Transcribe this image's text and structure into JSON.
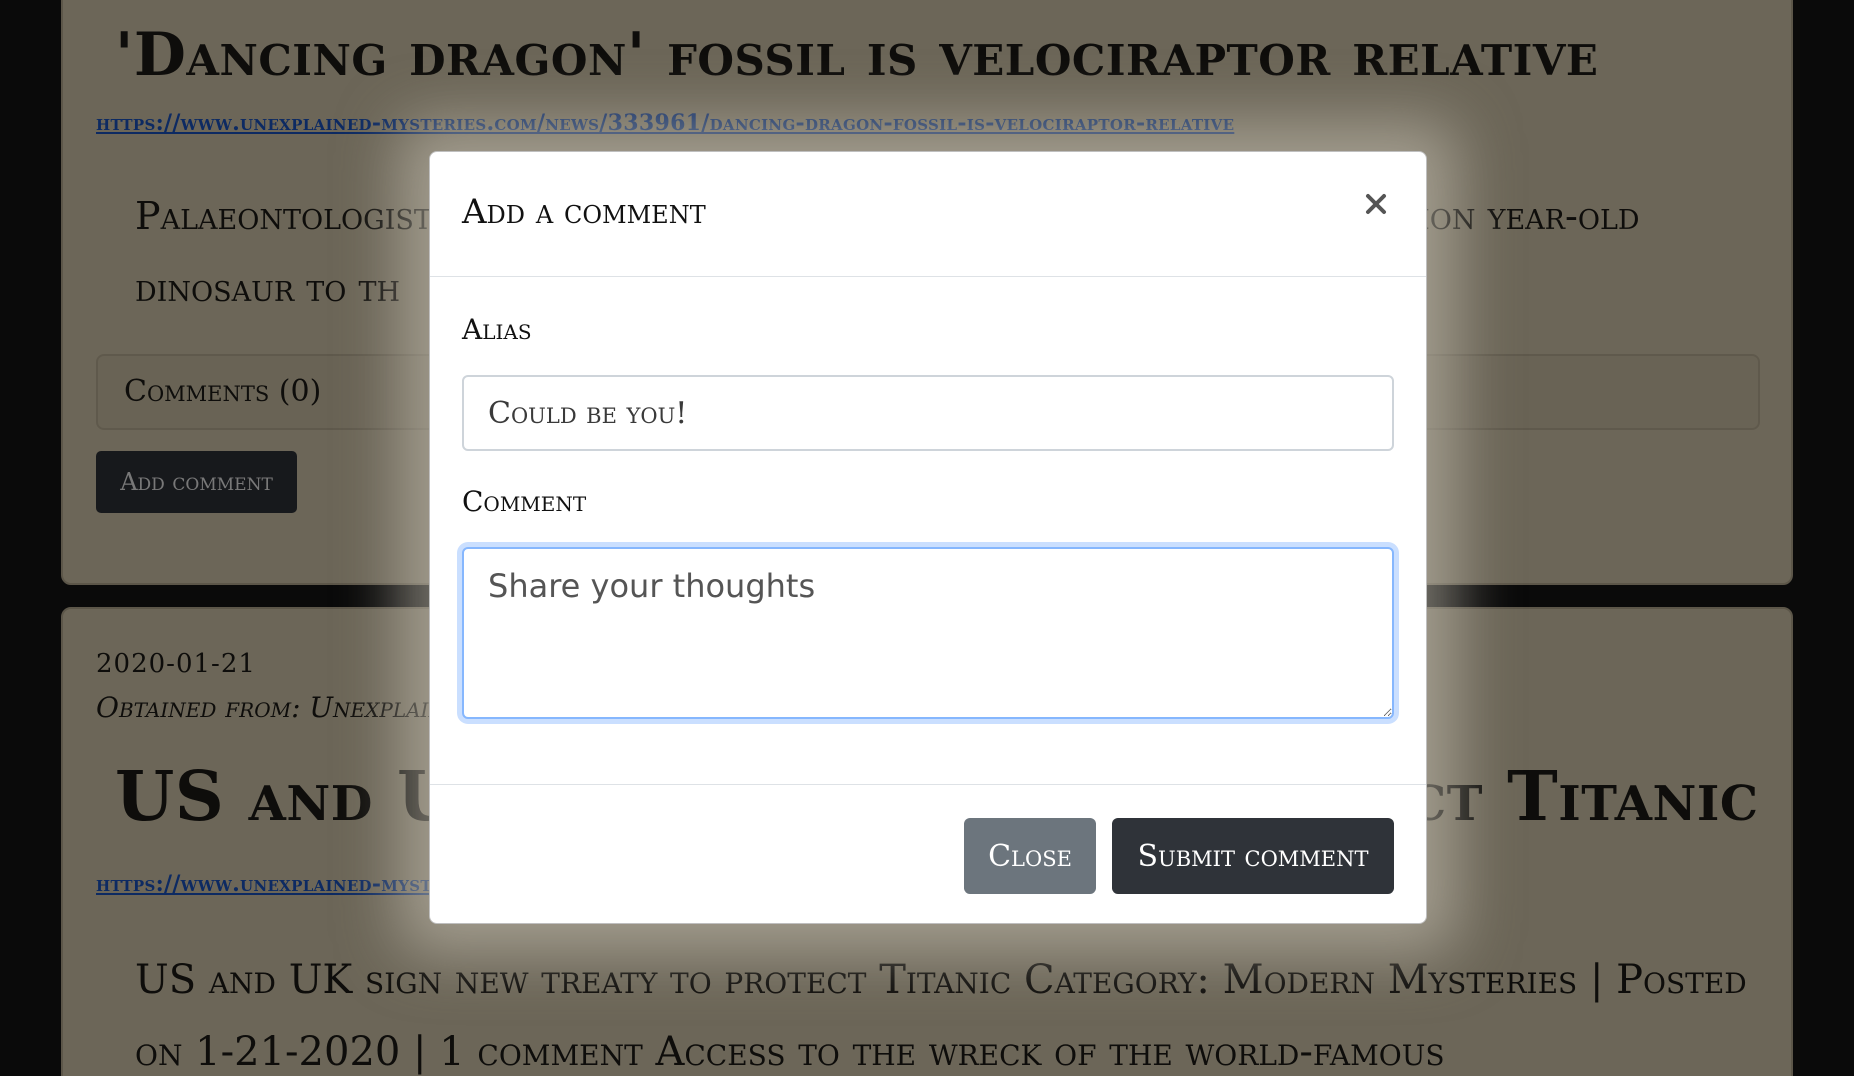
{
  "articles": [
    {
      "title": "'Dancing dragon' fossil is velociraptor relative",
      "link": "https://www.unexplained-mysteries.com/news/333961/dancing-dragon-fossil-is-velociraptor-relative",
      "body": "Palaeontologists have discovered the fossilized remains of a 120 million year-old dinosaur to th",
      "comments_label": "Comments (0)",
      "add_comment_label": "Add comment"
    },
    {
      "date": "2020-01-21",
      "source": "Obtained from: Unexplained Mysteries",
      "title": "US and UK sign new treaty to protect Titanic",
      "link": "https://www.unexplained-mysteries.com/news/333962/us-and-uk-sign-new-treaty-to-protect-titanic",
      "body": "US and UK sign new treaty to protect Titanic Category: Modern Mysteries | Posted on 1-21-2020 | 1 comment Access to the wreck of the world-famous"
    }
  ],
  "modal": {
    "title": "Add a comment",
    "close_icon": "close-icon",
    "alias_label": "Alias",
    "alias_placeholder": "Could be you!",
    "comment_label": "Comment",
    "comment_placeholder": "Share your thoughts",
    "close_button": "Close",
    "submit_button": "Submit comment"
  },
  "colors": {
    "link": "#1a55c4",
    "dark_button": "#2f3339",
    "secondary_button": "#6c757d",
    "focus_ring": "#86b7fe",
    "card_background": "#d9cdb0"
  }
}
